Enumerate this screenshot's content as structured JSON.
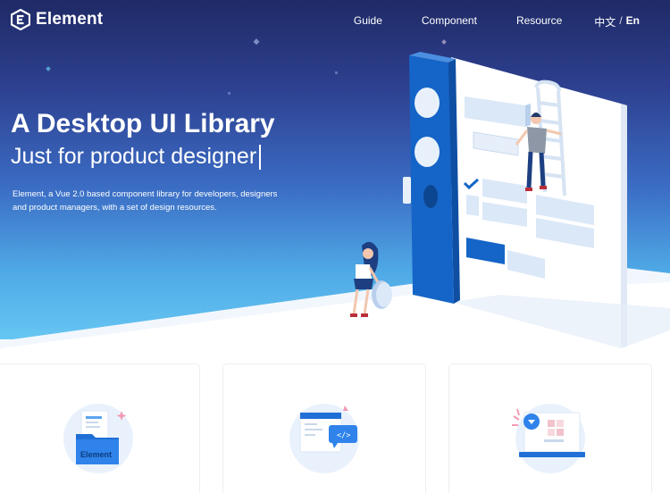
{
  "brand": {
    "name": "Element",
    "logo_icon": "hexagon-e-logo-icon"
  },
  "nav": {
    "links": [
      "Guide",
      "Component",
      "Resource"
    ],
    "lang_zh": "中文",
    "lang_sep": "/",
    "lang_en": "En"
  },
  "hero": {
    "title": "A Desktop UI Library",
    "subtitle": "Just for product designer",
    "description": "Element, a Vue 2.0 based component library for developers, designers and product managers, with a set of design resources."
  },
  "cards": [
    {
      "icon": "folder-docs-icon",
      "icon_label": "Element"
    },
    {
      "icon": "code-window-icon",
      "icon_label": "</>"
    },
    {
      "icon": "laptop-design-icon"
    }
  ],
  "colors": {
    "hero_top": "#1f2a66",
    "hero_bottom": "#66c6f2",
    "brand_blue": "#1f6fd6",
    "card_circle": "#e9f2fc"
  }
}
